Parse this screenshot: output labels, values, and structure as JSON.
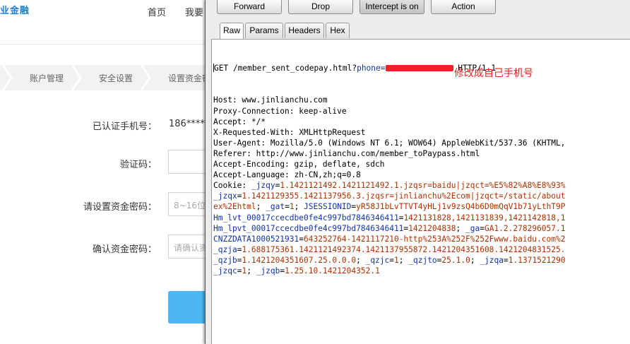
{
  "site": {
    "brand": "业金融",
    "nav": [
      "首页",
      "我要"
    ],
    "steps": [
      "账户管理",
      "安全设置",
      "设置资金密"
    ],
    "fields": [
      {
        "label": "已认证手机号：",
        "value": "186****"
      },
      {
        "label": "验证码：",
        "placeholder": ""
      },
      {
        "label": "请设置资金密码：",
        "placeholder": "8~16位"
      },
      {
        "label": "确认资金密码：",
        "placeholder": "请确认资"
      }
    ],
    "colors": {
      "brand": "#1e7fd8",
      "submit": "#4cb6f0"
    }
  },
  "burp": {
    "toolbar": {
      "forward": "Forward",
      "drop": "Drop",
      "intercept": "Intercept is on",
      "action": "Action"
    },
    "tabs": [
      "Raw",
      "Params",
      "Headers",
      "Hex"
    ],
    "active_tab": "Raw",
    "annotation": "修改成自己手机号",
    "request": {
      "line_prefix": "GET /member_sent_codepay.html?",
      "line_param": "phone=",
      "line_suffix": " HTTP/1.1",
      "headers": [
        "Host: www.jinlianchu.com",
        "Proxy-Connection: keep-alive",
        "Accept: */*",
        "X-Requested-With: XMLHttpRequest",
        "User-Agent: Mozilla/5.0 (Windows NT 6.1; WOW64) AppleWebKit/537.36 (KHTML,",
        "Referer: http://www.jinlianchu.com/member_toPaypass.html",
        "Accept-Encoding: gzip, deflate, sdch",
        "Accept-Language: zh-CN,zh;q=0.8"
      ],
      "cookie": [
        [
          {
            "t": "k",
            "s": "Cookie: "
          },
          {
            "t": "p",
            "s": "_jzqy"
          },
          {
            "t": "k",
            "s": "="
          },
          {
            "t": "v",
            "s": "1.1421121492.1421121492.1.jzqsr=baidu|jzqct=%E5%82%A8%E8%93%"
          }
        ],
        [
          {
            "t": "p",
            "s": "_jzqx"
          },
          {
            "t": "k",
            "s": "="
          },
          {
            "t": "v",
            "s": "1.1421129355.1421137956.3.jzqsr=jinlianchu%2Ecom|jzqct=/static/about"
          }
        ],
        [
          {
            "t": "v",
            "s": "ex%2Ehtml"
          },
          {
            "t": "k",
            "s": "; "
          },
          {
            "t": "p",
            "s": "_gat"
          },
          {
            "t": "k",
            "s": "="
          },
          {
            "t": "v",
            "s": "1"
          },
          {
            "t": "k",
            "s": "; "
          },
          {
            "t": "p",
            "s": "JSESSIONID"
          },
          {
            "t": "k",
            "s": "="
          },
          {
            "t": "v",
            "s": "yR58J1bLvTTVT4yHLj1v9zsQ4b6D0mQqV1b71yLthT9P"
          }
        ],
        [
          {
            "t": "p",
            "s": "Hm_lvt_00017ccecdbe0fe4c997bd7846346411"
          },
          {
            "t": "k",
            "s": "="
          },
          {
            "t": "v",
            "s": "1421131828,1421131839,1421142818,1"
          }
        ],
        [
          {
            "t": "p",
            "s": "Hm_lpvt_00017ccecdbe0fe4c997bd7846346411"
          },
          {
            "t": "k",
            "s": "="
          },
          {
            "t": "v",
            "s": "1421204838"
          },
          {
            "t": "k",
            "s": "; "
          },
          {
            "t": "p",
            "s": "_ga"
          },
          {
            "t": "k",
            "s": "="
          },
          {
            "t": "v",
            "s": "GA1.2.278296057.1"
          }
        ],
        [
          {
            "t": "p",
            "s": "CNZZDATA1000521931"
          },
          {
            "t": "k",
            "s": "="
          },
          {
            "t": "v",
            "s": "643252764-1421117210-http%253A%252F%252Fwww.baidu.com%2"
          }
        ],
        [
          {
            "t": "p",
            "s": "_qzja"
          },
          {
            "t": "k",
            "s": "="
          },
          {
            "t": "v",
            "s": "1.688175361.1421121492374.1421137955872.1421204351608.1421204831525."
          }
        ],
        [
          {
            "t": "p",
            "s": "_qzjb"
          },
          {
            "t": "k",
            "s": "="
          },
          {
            "t": "v",
            "s": "1.1421204351607.25.0.0.0"
          },
          {
            "t": "k",
            "s": "; "
          },
          {
            "t": "p",
            "s": "_qzjc"
          },
          {
            "t": "k",
            "s": "="
          },
          {
            "t": "v",
            "s": "1"
          },
          {
            "t": "k",
            "s": "; "
          },
          {
            "t": "p",
            "s": "_qzjto"
          },
          {
            "t": "k",
            "s": "="
          },
          {
            "t": "v",
            "s": "25.1.0"
          },
          {
            "t": "k",
            "s": "; "
          },
          {
            "t": "p",
            "s": "_jzqa"
          },
          {
            "t": "k",
            "s": "="
          },
          {
            "t": "v",
            "s": "1.1371521290"
          }
        ],
        [
          {
            "t": "p",
            "s": "_jzqc"
          },
          {
            "t": "k",
            "s": "="
          },
          {
            "t": "v",
            "s": "1"
          },
          {
            "t": "k",
            "s": "; "
          },
          {
            "t": "p",
            "s": "_jzqb"
          },
          {
            "t": "k",
            "s": "="
          },
          {
            "t": "v",
            "s": "1.25.10.1421204352.1"
          }
        ]
      ]
    },
    "colors": {
      "param": "#1133aa",
      "value": "#b03000",
      "annotation": "#e02020",
      "redaction": "#e8232a"
    }
  }
}
